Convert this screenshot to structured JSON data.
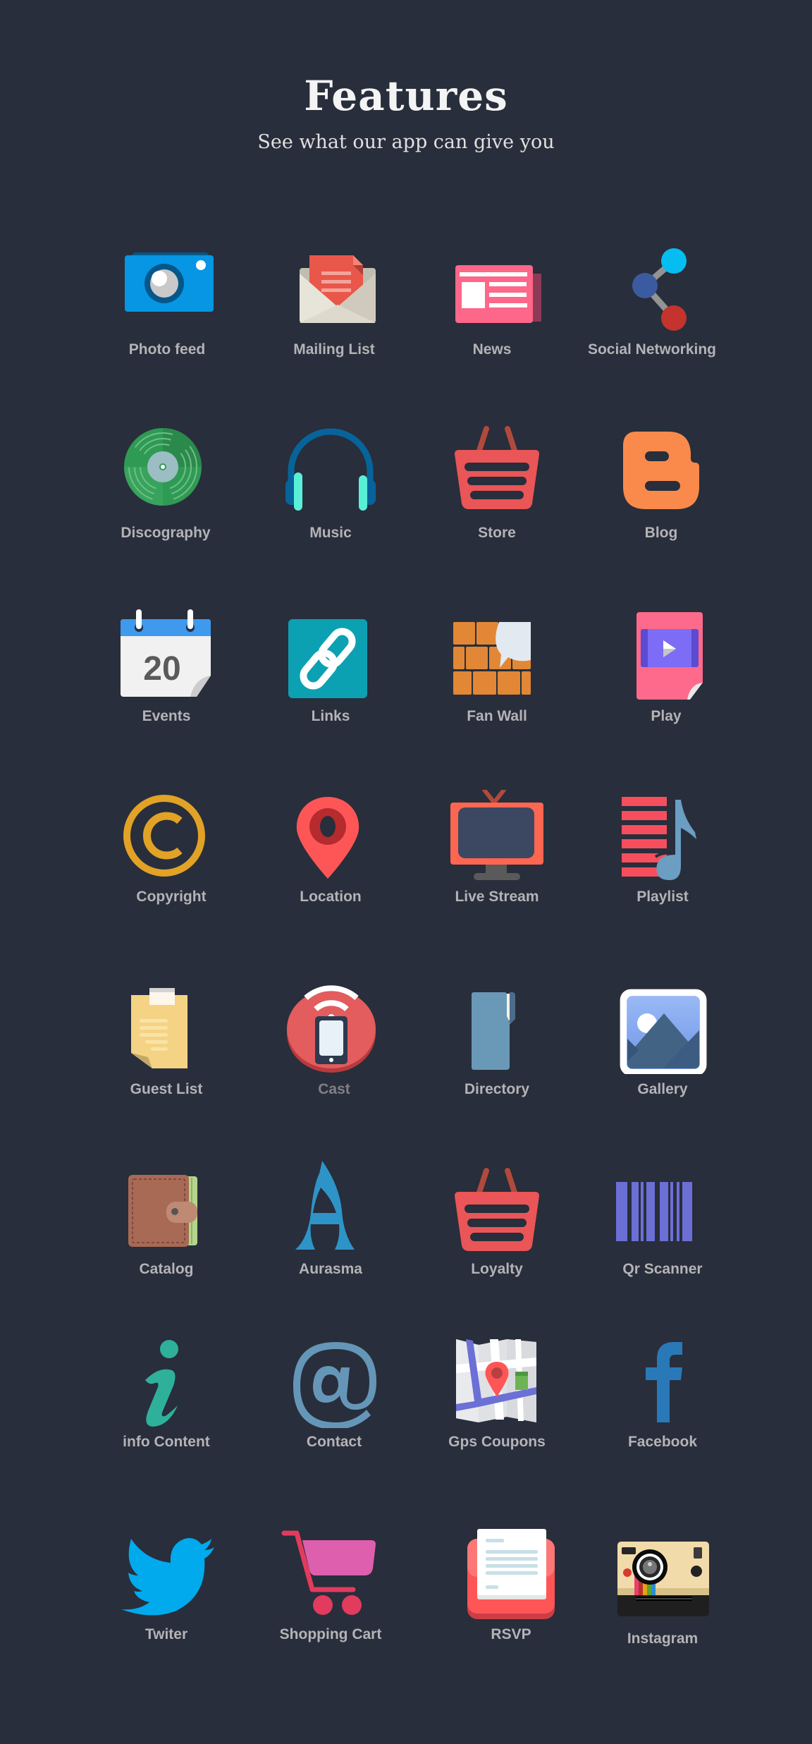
{
  "header": {
    "title": "Features",
    "subtitle": "See what our app can give you"
  },
  "colors": {
    "background": "#282e3b",
    "label": "#b4b3b6",
    "label_dim": "#808085"
  },
  "features": [
    {
      "label": "Photo feed",
      "icon": "camera-icon"
    },
    {
      "label": "Mailing List",
      "icon": "envelope-icon"
    },
    {
      "label": "News",
      "icon": "newspaper-icon"
    },
    {
      "label": "Social Networking",
      "icon": "share-icon"
    },
    {
      "label": "Discography",
      "icon": "vinyl-record-icon"
    },
    {
      "label": "Music",
      "icon": "headphones-icon"
    },
    {
      "label": "Store",
      "icon": "basket-icon"
    },
    {
      "label": "Blog",
      "icon": "blogger-icon"
    },
    {
      "label": "Events",
      "icon": "calendar-icon",
      "calendar_day": "20"
    },
    {
      "label": "Links",
      "icon": "chain-link-icon"
    },
    {
      "label": "Fan Wall",
      "icon": "brick-wall-speech-icon"
    },
    {
      "label": "Play",
      "icon": "video-file-icon"
    },
    {
      "label": "Copyright",
      "icon": "copyright-icon"
    },
    {
      "label": "Location",
      "icon": "map-pin-icon"
    },
    {
      "label": "Live Stream",
      "icon": "tv-icon"
    },
    {
      "label": "Playlist",
      "icon": "playlist-note-icon"
    },
    {
      "label": "Guest List",
      "icon": "sticky-note-icon"
    },
    {
      "label": "Cast",
      "icon": "cast-phone-icon",
      "dimmed": true
    },
    {
      "label": "Directory",
      "icon": "folder-icon"
    },
    {
      "label": "Gallery",
      "icon": "image-icon"
    },
    {
      "label": "Catalog",
      "icon": "wallet-icon"
    },
    {
      "label": "Aurasma",
      "icon": "aurasma-icon"
    },
    {
      "label": "Loyalty",
      "icon": "basket-icon"
    },
    {
      "label": "Qr Scanner",
      "icon": "barcode-icon"
    },
    {
      "label": "info Content",
      "icon": "info-icon"
    },
    {
      "label": "Contact",
      "icon": "at-sign-icon"
    },
    {
      "label": "Gps Coupons",
      "icon": "map-icon"
    },
    {
      "label": "Facebook",
      "icon": "facebook-icon"
    },
    {
      "label": "Twiter",
      "icon": "twitter-bird-icon"
    },
    {
      "label": "Shopping Cart",
      "icon": "shopping-cart-icon"
    },
    {
      "label": "RSVP",
      "icon": "rsvp-card-icon"
    },
    {
      "label": "Instagram",
      "icon": "instagram-camera-icon"
    }
  ]
}
